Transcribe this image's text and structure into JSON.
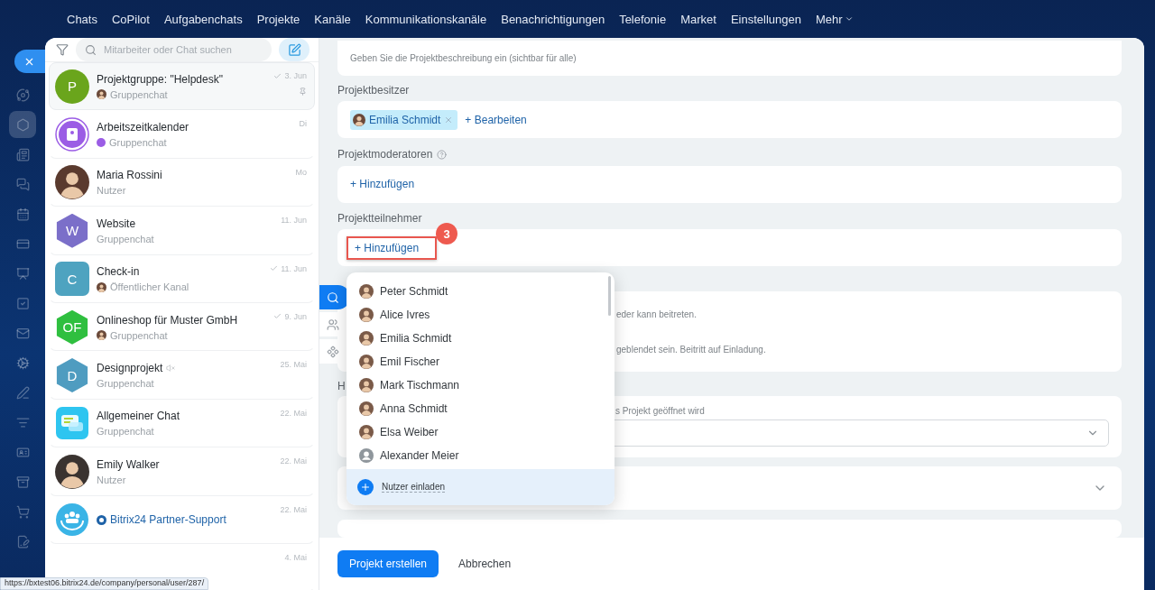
{
  "top_nav": [
    {
      "label": "Chats",
      "has_menu": false
    },
    {
      "label": "CoPilot",
      "has_menu": false
    },
    {
      "label": "Aufgabenchats",
      "has_menu": false
    },
    {
      "label": "Projekte",
      "has_menu": false
    },
    {
      "label": "Kanäle",
      "has_menu": false
    },
    {
      "label": "Kommunikationskanäle",
      "has_menu": false
    },
    {
      "label": "Benachrichtigungen",
      "has_menu": false
    },
    {
      "label": "Telefonie",
      "has_menu": false
    },
    {
      "label": "Market",
      "has_menu": false
    },
    {
      "label": "Einstellungen",
      "has_menu": false
    },
    {
      "label": "Mehr",
      "has_menu": true
    }
  ],
  "rail": [
    {
      "kind": "orbit",
      "selected": false
    },
    {
      "kind": "hexagon",
      "selected": true
    },
    {
      "kind": "news",
      "selected": false
    },
    {
      "kind": "messages",
      "selected": false
    },
    {
      "kind": "calendar",
      "selected": false
    },
    {
      "kind": "card",
      "selected": false
    },
    {
      "kind": "board",
      "selected": false
    },
    {
      "kind": "tasks",
      "selected": false
    },
    {
      "kind": "mail",
      "selected": false
    },
    {
      "kind": "automation",
      "selected": false
    },
    {
      "kind": "sign",
      "selected": false
    },
    {
      "kind": "funnel",
      "selected": false
    },
    {
      "kind": "contact",
      "selected": false
    },
    {
      "kind": "archive",
      "selected": false
    },
    {
      "kind": "cart",
      "selected": false
    },
    {
      "kind": "document",
      "selected": false
    }
  ],
  "chat_panel": {
    "search": {
      "placeholder": "Mitarbeiter oder Chat suchen"
    },
    "chats": [
      {
        "name": "Projektgruppe: \"Helpdesk\"",
        "subtitle": "Gruppenchat",
        "subtitle_badge": {
          "kind": "avatar"
        },
        "date": "3. Jun",
        "read": true,
        "pinned": true,
        "muted": false,
        "official": false,
        "selected": true,
        "avatar": {
          "kind": "letter-circle",
          "letter": "P",
          "color": "#6aa51c"
        }
      },
      {
        "name": "Arbeitszeitkalender",
        "subtitle": "Gruppenchat",
        "subtitle_badge": {
          "kind": "dot"
        },
        "date": "Di",
        "read": false,
        "pinned": false,
        "muted": false,
        "official": false,
        "selected": false,
        "avatar": {
          "kind": "calendar",
          "color": "#9b5de5"
        }
      },
      {
        "name": "Maria Rossini",
        "subtitle": "Nutzer",
        "date": "Mo",
        "read": false,
        "pinned": false,
        "muted": false,
        "official": false,
        "selected": false,
        "avatar": {
          "kind": "photo",
          "color": "#5a3a2e"
        }
      },
      {
        "name": "Website",
        "subtitle": "Gruppenchat",
        "date": "11. Jun",
        "read": false,
        "pinned": false,
        "muted": false,
        "official": false,
        "selected": false,
        "avatar": {
          "kind": "letter-hex",
          "letter": "W",
          "color": "#7b6fc9"
        }
      },
      {
        "name": "Check-in",
        "subtitle": "Öffentlicher Kanal",
        "subtitle_badge": {
          "kind": "avatar"
        },
        "date": "11. Jun",
        "read": true,
        "pinned": false,
        "muted": false,
        "official": false,
        "selected": false,
        "avatar": {
          "kind": "letter-square",
          "letter": "C",
          "color": "#4ea3c0"
        }
      },
      {
        "name": "Onlineshop für Muster GmbH",
        "subtitle": "Gruppenchat",
        "subtitle_badge": {
          "kind": "avatar"
        },
        "date": "9. Jun",
        "read": true,
        "pinned": false,
        "muted": false,
        "official": false,
        "selected": false,
        "avatar": {
          "kind": "letter-hex",
          "letter": "OF",
          "color": "#2fbf3f"
        }
      },
      {
        "name": "Designprojekt",
        "subtitle": "Gruppenchat",
        "date": "25. Mai",
        "read": false,
        "pinned": false,
        "muted": true,
        "official": false,
        "selected": false,
        "avatar": {
          "kind": "letter-hex",
          "letter": "D",
          "color": "#4f9cc0"
        }
      },
      {
        "name": "Allgemeiner Chat",
        "subtitle": "Gruppenchat",
        "date": "22. Mai",
        "read": false,
        "pinned": false,
        "muted": false,
        "official": false,
        "selected": false,
        "avatar": {
          "kind": "chat",
          "color": "#2ec5f0"
        }
      },
      {
        "name": "Emily Walker",
        "subtitle": "Nutzer",
        "date": "22. Mai",
        "read": false,
        "pinned": false,
        "muted": false,
        "official": false,
        "selected": false,
        "avatar": {
          "kind": "photo",
          "color": "#3a3330"
        }
      },
      {
        "name": "Bitrix24 Partner-Support",
        "date": "22. Mai",
        "read": false,
        "pinned": false,
        "muted": false,
        "official": true,
        "selected": false,
        "avatar": {
          "kind": "support",
          "color": "#3ab4e6"
        }
      },
      {
        "date": "4. Mai",
        "read": false,
        "pinned": false,
        "muted": false,
        "official": false,
        "selected": false
      }
    ]
  },
  "form": {
    "description": {
      "placeholder": "Geben Sie die Projektbeschreibung ein (sichtbar für alle)"
    },
    "owner": {
      "label": "Projektbesitzer",
      "chip": "Emilia Schmidt",
      "edit_link": "+ Bearbeiten"
    },
    "moderators": {
      "label": "Projektmoderatoren",
      "add_link": "+ Hinzufügen"
    },
    "participants": {
      "label": "Projektteilnehmer",
      "add_link": "+ Hinzufügen",
      "step_badge": "3"
    },
    "visibility": {
      "line_1": "eder kann beitreten.",
      "line_2": "geblendet sein. Beitritt auf Einladung."
    },
    "start_page": {
      "label": "H",
      "hint": "s Projekt geöffnet wird"
    },
    "access_card": {
      "expanded": false
    }
  },
  "user_picker": {
    "users": [
      {
        "name": "Peter Schmidt",
        "photo": true
      },
      {
        "name": "Alice Ivres",
        "photo": true
      },
      {
        "name": "Emilia Schmidt",
        "photo": true
      },
      {
        "name": "Emil Fischer",
        "photo": true
      },
      {
        "name": "Mark Tischmann",
        "photo": true
      },
      {
        "name": "Anna Schmidt",
        "photo": true
      },
      {
        "name": "Elsa Weiber",
        "photo": true
      },
      {
        "name": "Alexander Meier",
        "photo": false
      }
    ],
    "invite": "Nutzer einladen"
  },
  "side_tabs": [
    {
      "kind": "search",
      "selected": true
    },
    {
      "kind": "people",
      "selected": false
    },
    {
      "kind": "groups",
      "selected": false
    }
  ],
  "footer": {
    "primary": "Projekt erstellen",
    "secondary": "Abbrechen"
  },
  "status_url": "https://bxtest06.bitrix24.de/company/personal/user/287/"
}
